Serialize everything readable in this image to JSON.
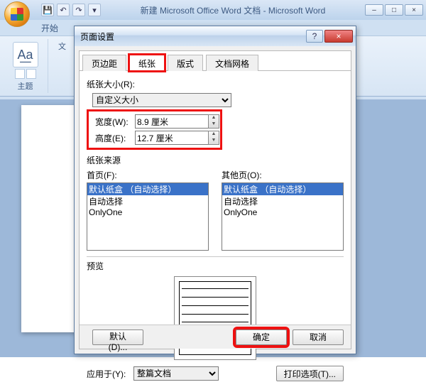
{
  "window": {
    "title": "新建 Microsoft Office Word 文档 - Microsoft Word",
    "qat": {
      "save": "💾",
      "undo": "↶",
      "redo": "↷",
      "more": "▾"
    },
    "ctrls": {
      "min": "–",
      "max": "□",
      "close": "×"
    }
  },
  "ribbon": {
    "tab_home": "开始",
    "group_theme": "主题",
    "group_text": "文",
    "theme_icon": "A͟a"
  },
  "dialog": {
    "title": "页面设置",
    "help": "?",
    "close": "×",
    "tabs": {
      "margins": "页边距",
      "paper": "纸张",
      "layout": "版式",
      "grid": "文档网格"
    },
    "paper_size_label": "纸张大小(R):",
    "paper_size_value": "自定义大小",
    "width_label": "宽度(W):",
    "width_value": "8.9 厘米",
    "height_label": "高度(E):",
    "height_value": "12.7 厘米",
    "source_label": "纸张来源",
    "first_page_label": "首页(F):",
    "other_pages_label": "其他页(O):",
    "tray_options": {
      "default": "默认纸盒 （自动选择）",
      "auto": "自动选择",
      "onlyone": "OnlyOne"
    },
    "preview_label": "预览",
    "apply_to_label": "应用于(Y):",
    "apply_to_value": "整篇文档",
    "print_options": "打印选项(T)...",
    "default_btn": "默认(D)...",
    "ok": "确定",
    "cancel": "取消"
  }
}
